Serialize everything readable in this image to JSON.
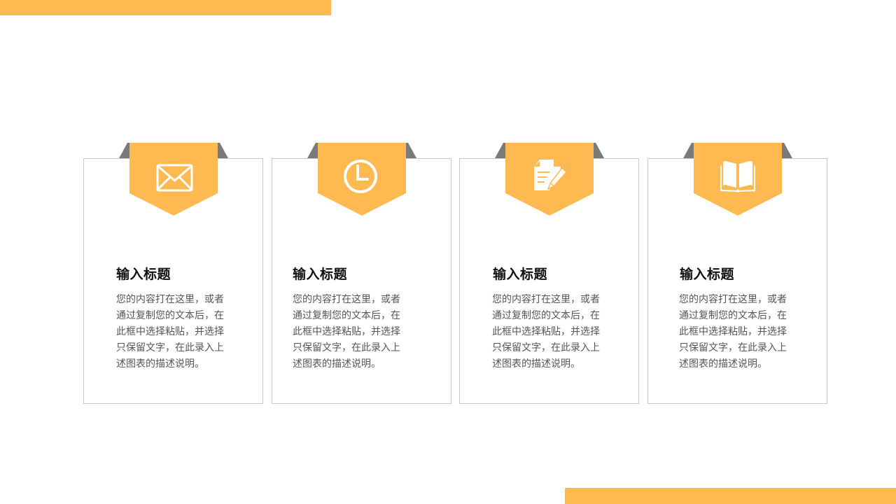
{
  "colors": {
    "accent": "#FFB951",
    "fold_shadow": "#7a7a7a",
    "card_border": "#c8c8c8"
  },
  "cards": [
    {
      "icon": "envelope-icon",
      "title": "输入标题",
      "body_lines": [
        "您的内容打在这里，或者",
        "通过复制您的文本后，在",
        "此框中选择粘贴，并选择",
        "只保留文字，在此录入上",
        "述图表的描述说明。"
      ]
    },
    {
      "icon": "clock-icon",
      "title": "输入标题",
      "body_lines": [
        "您的内容打在这里，或者",
        "通过复制您的文本后，在",
        "此框中选择粘贴，并选择",
        "只保留文字，在此录入上",
        "述图表的描述说明。"
      ]
    },
    {
      "icon": "edit-document-icon",
      "title": "输入标题",
      "body_lines": [
        "您的内容打在这里，或者",
        "通过复制您的文本后，在",
        "此框中选择粘贴，并选择",
        "只保留文字，在此录入上",
        "述图表的描述说明。"
      ]
    },
    {
      "icon": "open-book-icon",
      "title": "输入标题",
      "body_lines": [
        "您的内容打在这里，或者",
        "通过复制您的文本后，在",
        "此框中选择粘贴，并选择",
        "只保留文字，在此录入上",
        "述图表的描述说明。"
      ]
    }
  ]
}
